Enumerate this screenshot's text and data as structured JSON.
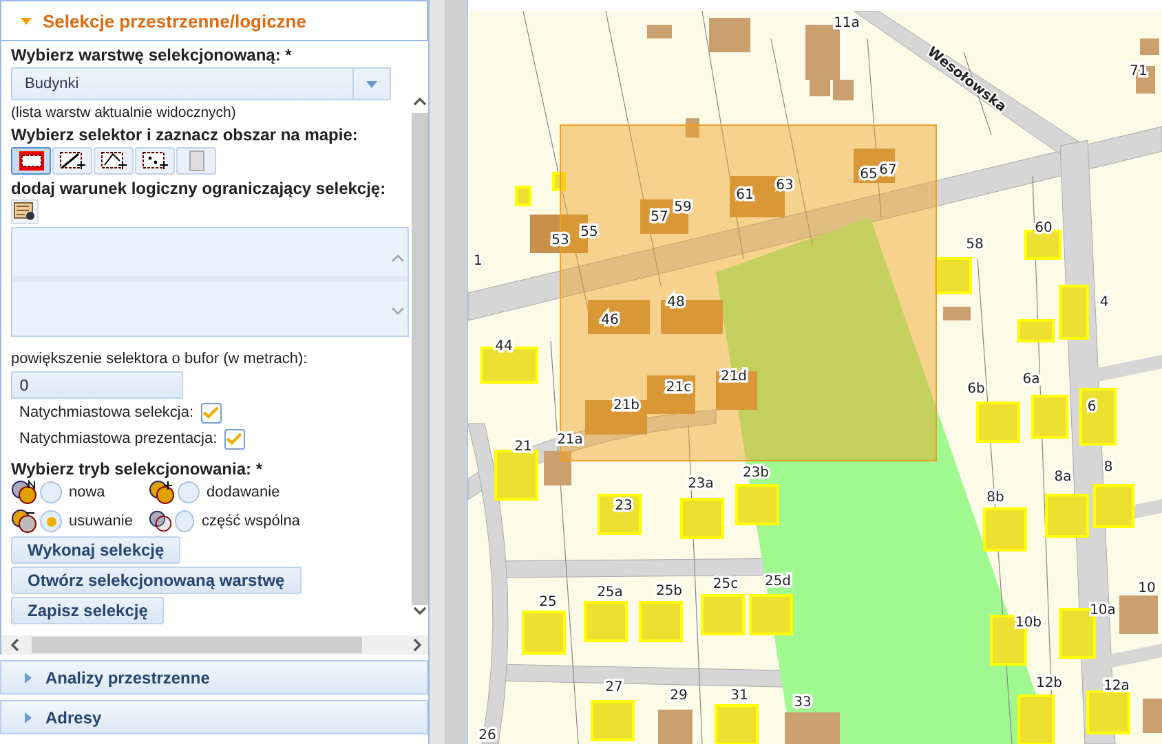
{
  "panel": {
    "title": "Selekcje przestrzenne/logiczne",
    "expanded": true
  },
  "layer_field": {
    "label": "Wybierz warstwę selekcjonowaną: *",
    "value": "Budynki",
    "hint": "(lista warstw aktualnie widocznych)"
  },
  "selector": {
    "label": "Wybierz selektor i zaznacz obszar na mapie:",
    "tools": [
      {
        "kind": "rectangle",
        "selected": true
      },
      {
        "kind": "line",
        "selected": false
      },
      {
        "kind": "polygon",
        "selected": false
      },
      {
        "kind": "point",
        "selected": false
      },
      {
        "kind": "blank",
        "selected": false
      }
    ]
  },
  "condition": {
    "label": "dodaj warunek logiczny ograniczający selekcję:"
  },
  "buffer": {
    "label": "powiększenie selektora o bufor (w metrach):",
    "value": "0"
  },
  "options": [
    {
      "label": "Natychmiastowa selekcja:",
      "checked": true
    },
    {
      "label": "Natychmiastowa prezentacja:",
      "checked": true
    }
  ],
  "mode": {
    "label": "Wybierz tryb selekcjonowania: *",
    "options": [
      {
        "label": "nowa",
        "kind": "new",
        "selected": false
      },
      {
        "label": "dodawanie",
        "kind": "add",
        "selected": false
      },
      {
        "label": "usuwanie",
        "kind": "subtract",
        "selected": true
      },
      {
        "label": "część wspólna",
        "kind": "intersect",
        "selected": false
      }
    ]
  },
  "buttons": [
    "Wykonaj selekcję",
    "Otwórz selekcjonowaną warstwę",
    "Zapisz selekcję"
  ],
  "sections": [
    {
      "title": "Analizy przestrzenne",
      "expanded": false
    },
    {
      "title": "Adresy",
      "expanded": false
    }
  ],
  "map": {
    "street": "Wesołowska",
    "labels": [
      "11a",
      "71",
      "53",
      "55",
      "57",
      "59",
      "61",
      "63",
      "65",
      "67",
      "58",
      "60",
      "48",
      "46",
      "44",
      "21d",
      "21c",
      "21b",
      "21a",
      "21",
      "23b",
      "23a",
      "23",
      "25",
      "25a",
      "25b",
      "25c",
      "25d",
      "27",
      "29",
      "31",
      "33",
      "26",
      "10",
      "10a",
      "10b",
      "12b",
      "12a",
      "8a",
      "8b",
      "8",
      "6b",
      "6a",
      "4",
      "6",
      "1"
    ]
  }
}
